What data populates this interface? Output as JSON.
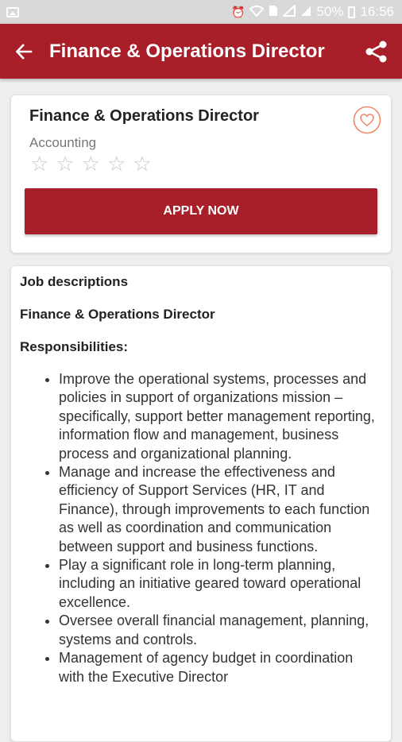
{
  "status_bar": {
    "battery_percent": "50%",
    "time": "16:56"
  },
  "app_bar": {
    "title": "Finance & Operations Director",
    "back_icon": "arrow-left-icon",
    "share_icon": "share-icon"
  },
  "job": {
    "title": "Finance & Operations Director",
    "category": "Accounting",
    "rating": 0,
    "rating_max": 5,
    "apply_label": "APPLY NOW",
    "favorite_icon": "heart-icon"
  },
  "description": {
    "heading": "Job descriptions",
    "subtitle": "Finance & Operations Director",
    "responsibilities_heading": "Responsibilities:",
    "items": [
      "Improve the operational systems, processes and policies in support of organizations mission – specifically, support better management reporting, information flow and management, business process and organizational planning.",
      "Manage and increase the effectiveness and efficiency of Support Services (HR, IT and Finance), through improvements to each function as well as coordination and communication between support and business functions.",
      "Play a significant role in long-term planning, including an initiative geared toward operational excellence.",
      "Oversee overall financial management, planning, systems and controls.",
      "Management of agency budget in coordination with the Executive Director"
    ]
  },
  "colors": {
    "primary": "#a81f2a",
    "favorite_accent": "#f08a6b",
    "status_bar": "#d9d9d9"
  }
}
